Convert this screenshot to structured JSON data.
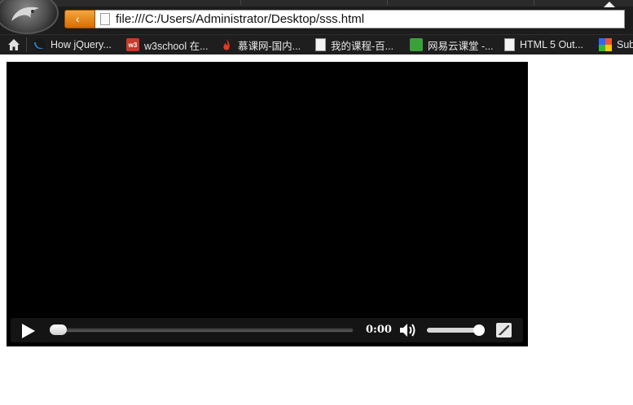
{
  "browser": {
    "url": "file:///C:/Users/Administrator/Desktop/sss.html",
    "back_glyph": "‹",
    "bookmarks": [
      {
        "label": "How jQuery...",
        "icon": "jquery-icon"
      },
      {
        "label": "w3school 在...",
        "icon": "w3school-icon",
        "badge": "w3"
      },
      {
        "label": "慕课网-国内...",
        "icon": "flame-icon"
      },
      {
        "label": "我的课程-百...",
        "icon": "page-icon"
      },
      {
        "label": "网易云课堂 -...",
        "icon": "netease-icon"
      },
      {
        "label": "HTML 5 Out...",
        "icon": "page-icon"
      },
      {
        "label": "Sub",
        "icon": "sub-icon"
      }
    ]
  },
  "video": {
    "current_time": "0:00",
    "progress": 0.0,
    "volume": 1.0,
    "icons": [
      "play-icon",
      "volume-icon",
      "fullscreen-icon"
    ]
  }
}
